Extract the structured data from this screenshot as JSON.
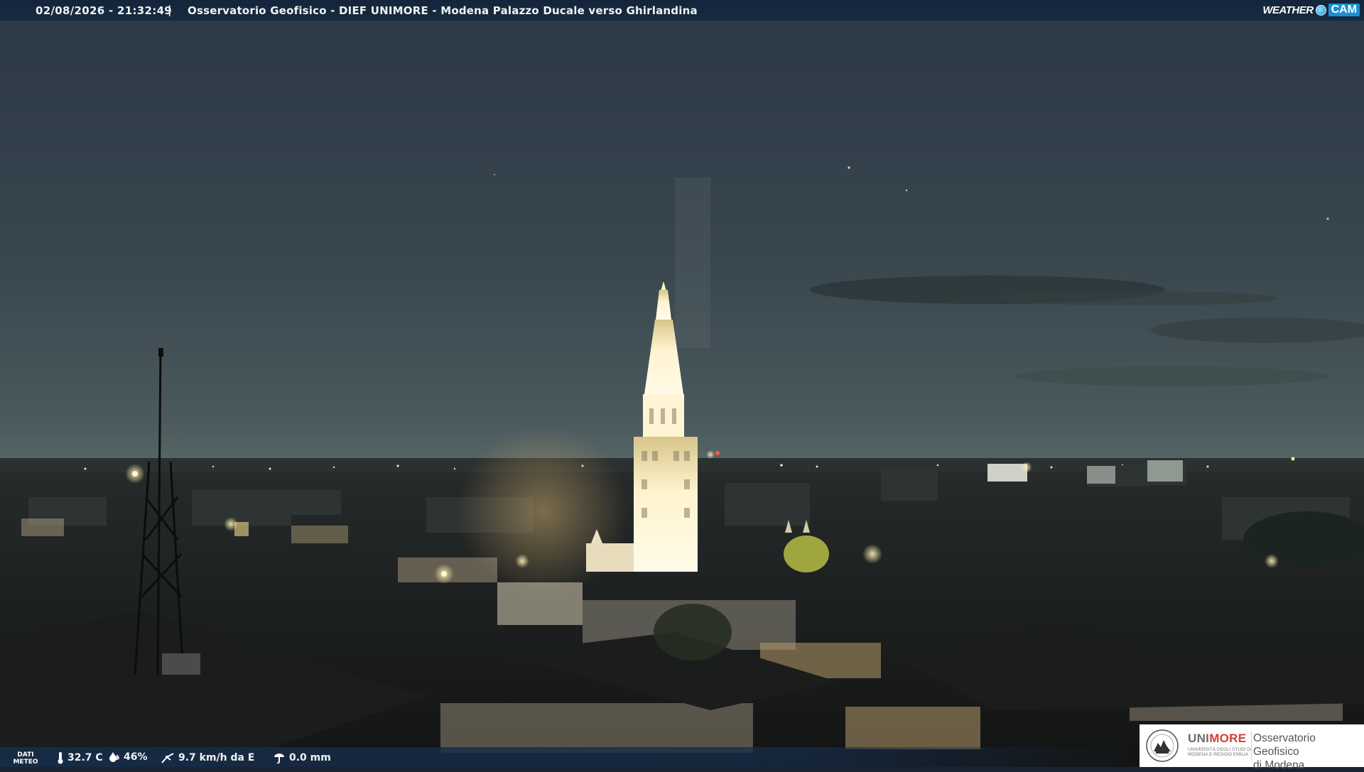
{
  "header": {
    "timestamp": "02/08/2026 - 21:32:49",
    "separator": "|",
    "title": "Osservatorio Geofisico - DIEF UNIMORE - Modena Palazzo Ducale verso Ghirlandina"
  },
  "brand": {
    "part1": "WEATHER",
    "part2": "CAM"
  },
  "weather": {
    "label_line1": "DATI",
    "label_line2": "METEO",
    "temperature": "32.7 C",
    "humidity": "46%",
    "wind": "9.7 km/h da E",
    "rain": "0.0 mm"
  },
  "institution": {
    "name_uni": "UNI",
    "name_more": "MORE",
    "name_sub": "UNIVERSITÀ DEGLI STUDI DI MODENA E REGGIO EMILIA",
    "observatory_line1": "Osservatorio Geofisico",
    "observatory_line2": "di Modena"
  },
  "colors": {
    "sky_top": "#2c3a48",
    "sky_horizon": "#6a7a80",
    "tower_lit": "#fff8e0",
    "bar_bg": "#16304c",
    "accent_red": "#d4412a",
    "accent_blue": "#1a8fd1"
  },
  "icons": {
    "temperature": "thermometer-icon",
    "humidity": "droplet-icon",
    "wind": "wind-icon",
    "rain": "rain-gauge-icon",
    "seal": "university-seal-icon"
  }
}
